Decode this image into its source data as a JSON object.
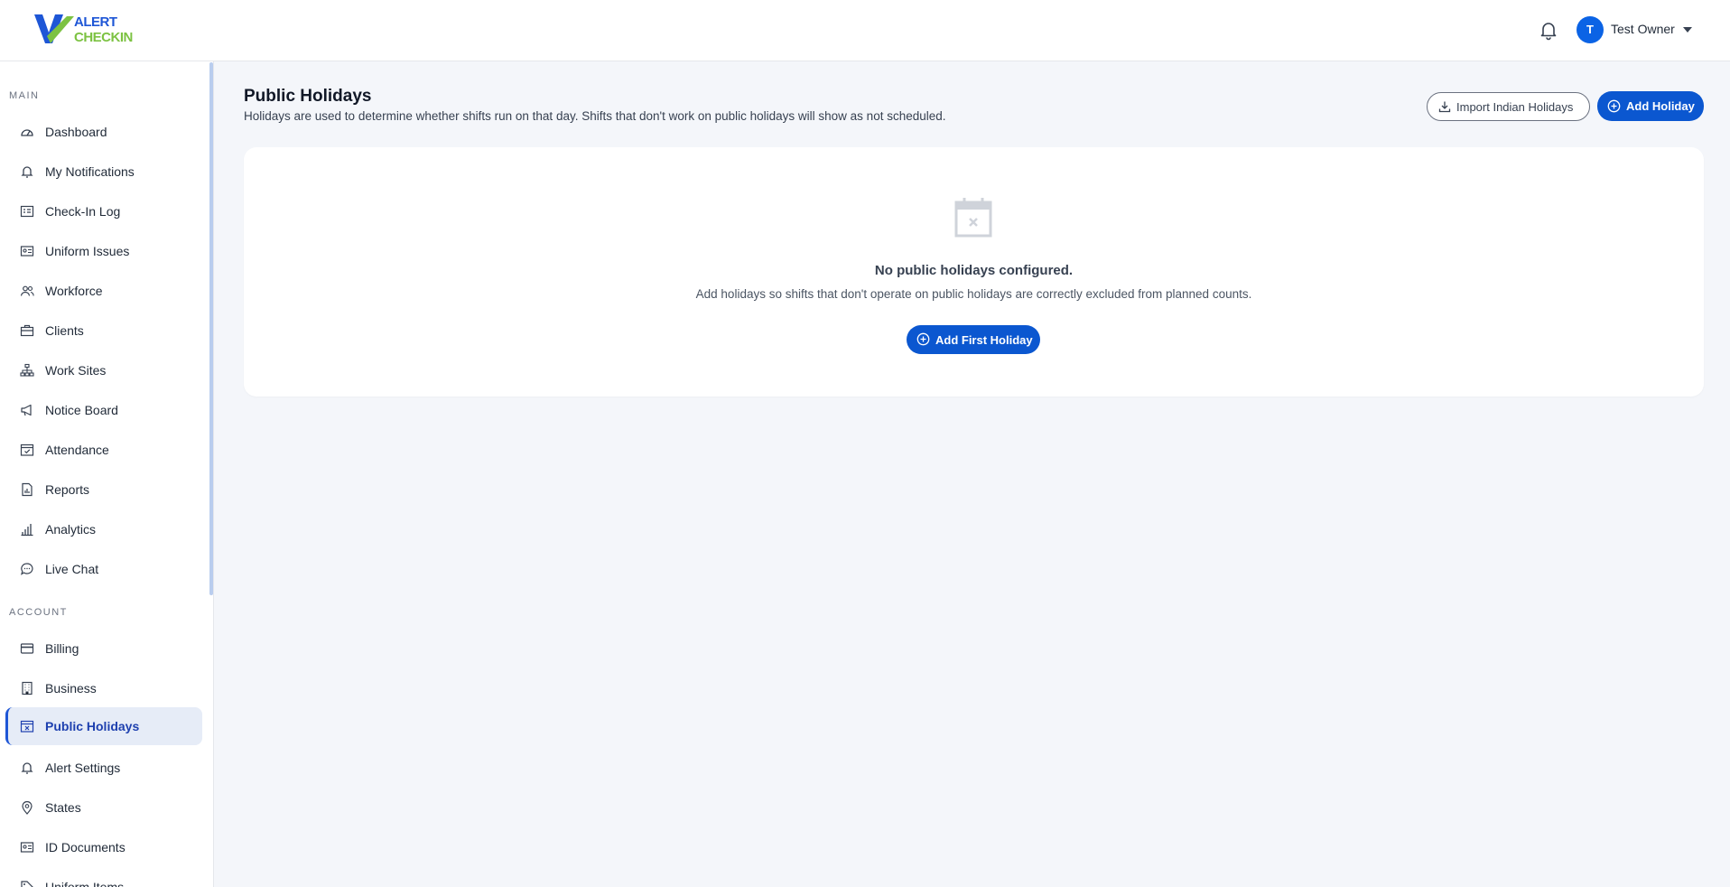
{
  "app": {
    "logo_line1": "ALERT",
    "logo_line2": "CHECKIN",
    "brand_blue": "#1e56d6",
    "brand_green": "#7cc242"
  },
  "header": {
    "user_initial": "T",
    "user_name": "Test Owner",
    "icons": [
      "bell-icon",
      "chevron-down-icon"
    ]
  },
  "sidebar": {
    "main_label": "MAIN",
    "account_label": "ACCOUNT",
    "main_items": [
      {
        "label": "Dashboard",
        "icon": "dashboard-gauge-icon"
      },
      {
        "label": "My Notifications",
        "icon": "bell-icon"
      },
      {
        "label": "Check-In Log",
        "icon": "list-icon"
      },
      {
        "label": "Uniform Issues",
        "icon": "id-card-icon"
      },
      {
        "label": "Workforce",
        "icon": "users-icon"
      },
      {
        "label": "Clients",
        "icon": "briefcase-icon"
      },
      {
        "label": "Work Sites",
        "icon": "sitemap-icon"
      },
      {
        "label": "Notice Board",
        "icon": "megaphone-icon"
      },
      {
        "label": "Attendance",
        "icon": "calendar-check-icon"
      },
      {
        "label": "Reports",
        "icon": "report-icon"
      },
      {
        "label": "Analytics",
        "icon": "bar-chart-icon"
      },
      {
        "label": "Live Chat",
        "icon": "chat-icon"
      }
    ],
    "account_items": [
      {
        "label": "Billing",
        "icon": "credit-card-icon"
      },
      {
        "label": "Business",
        "icon": "building-icon"
      },
      {
        "label": "Public Holidays",
        "icon": "calendar-x-icon",
        "active": true
      },
      {
        "label": "Alert Settings",
        "icon": "bell-icon"
      },
      {
        "label": "States",
        "icon": "map-pin-icon"
      },
      {
        "label": "ID Documents",
        "icon": "id-card-icon"
      },
      {
        "label": "Uniform Items",
        "icon": "tag-icon"
      }
    ]
  },
  "main": {
    "title": "Public Holidays",
    "subtitle": "Holidays are used to determine whether shifts run on that day. Shifts that don't work on public holidays will show as not scheduled.",
    "import_button": "Import Indian Holidays",
    "add_button": "Add Holiday",
    "empty_state": {
      "title": "No public holidays configured.",
      "message": "Add holidays so shifts that don't operate on public holidays are correctly excluded from planned counts.",
      "button": "Add First Holiday"
    },
    "accent": "#0b57d0"
  }
}
